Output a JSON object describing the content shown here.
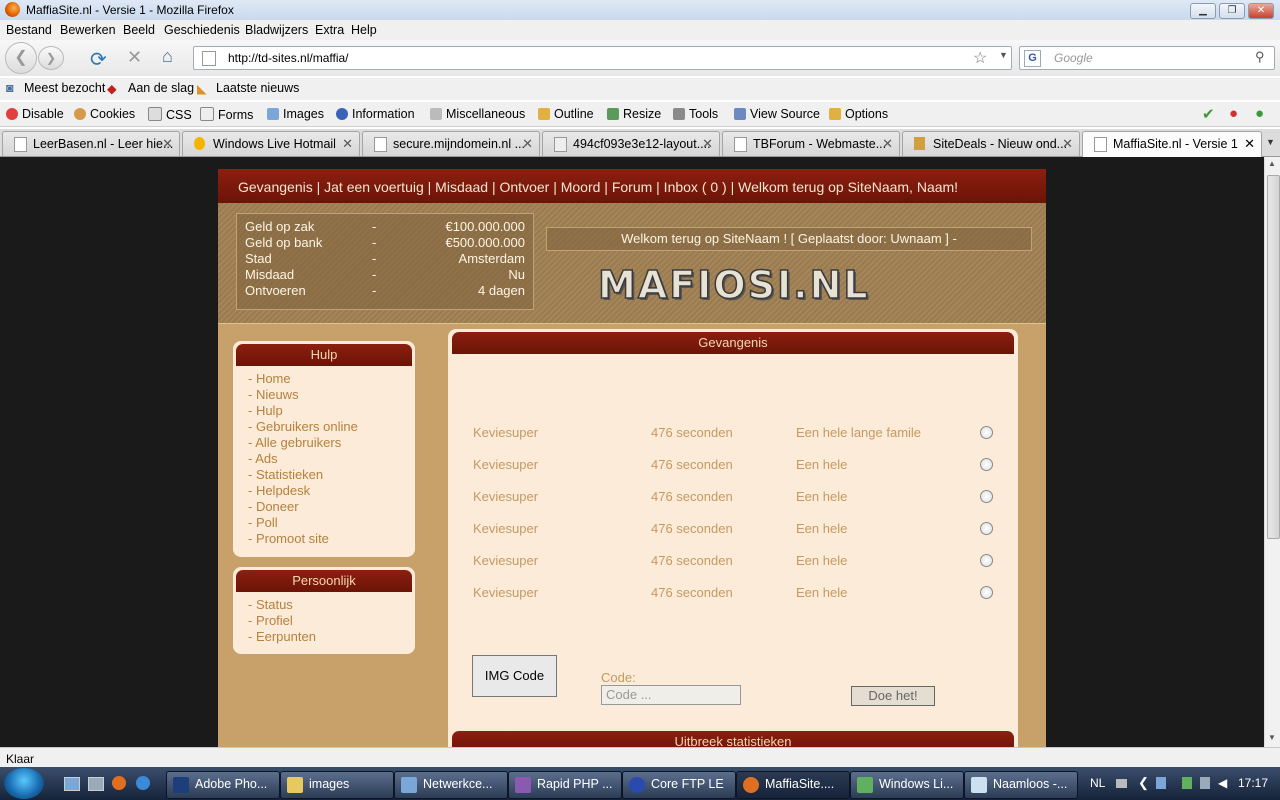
{
  "window": {
    "title": "MaffiaSite.nl - Versie 1 - Mozilla Firefox"
  },
  "menu": [
    "Bestand",
    "Bewerken",
    "Beeld",
    "Geschiedenis",
    "Bladwijzers",
    "Extra",
    "Help"
  ],
  "nav": {
    "url": "http://td-sites.nl/maffia/",
    "search_placeholder": "Google"
  },
  "bookmarks": [
    "Meest bezocht",
    "Aan de slag",
    "Laatste nieuws"
  ],
  "devtools": [
    "Disable",
    "Cookies",
    "CSS",
    "Forms",
    "Images",
    "Information",
    "Miscellaneous",
    "Outline",
    "Resize",
    "Tools",
    "View Source",
    "Options"
  ],
  "tabs": [
    {
      "label": "LeerBasen.nl - Leer hie..."
    },
    {
      "label": "Windows Live Hotmail"
    },
    {
      "label": "secure.mijndomein.nl ..."
    },
    {
      "label": "494cf093e3e12-layout...."
    },
    {
      "label": "TBForum - Webmaste..."
    },
    {
      "label": "SiteDeals - Nieuw ond..."
    },
    {
      "label": "MaffiaSite.nl - Versie 1"
    }
  ],
  "site": {
    "topnav": "Gevangenis | Jat een voertuig | Misdaad | Ontvoer | Moord | Forum | Inbox ( 0 ) | Welkom terug op SiteNaam, Naam!",
    "stats": [
      {
        "label": "Geld op zak",
        "sep": "-",
        "value": "€100.000.000"
      },
      {
        "label": "Geld op bank",
        "sep": "-",
        "value": "€500.000.000"
      },
      {
        "label": "Stad",
        "sep": "-",
        "value": "Amsterdam"
      },
      {
        "label": "Misdaad",
        "sep": "-",
        "value": "Nu"
      },
      {
        "label": "Ontvoeren",
        "sep": "-",
        "value": "4 dagen"
      }
    ],
    "welcome": "Welkom terug op SiteNaam ! [ Geplaatst door: Uwnaam ] -",
    "logo": "MAFIOSI.NL",
    "hulp": {
      "title": "Hulp",
      "links": [
        "- Home",
        "- Nieuws",
        "- Hulp",
        "- Gebruikers online",
        "- Alle gebruikers",
        "- Ads",
        "- Statistieken",
        "- Helpdesk",
        "- Doneer",
        "- Poll",
        "- Promoot site"
      ]
    },
    "persoonlijk": {
      "title": "Persoonlijk",
      "links": [
        "- Status",
        "- Profiel",
        "- Eerpunten"
      ]
    },
    "gevangenis": {
      "title": "Gevangenis",
      "rows": [
        {
          "name": "Keviesuper",
          "time": "476 seconden",
          "family": "Een hele lange famile"
        },
        {
          "name": "Keviesuper",
          "time": "476 seconden",
          "family": "Een hele"
        },
        {
          "name": "Keviesuper",
          "time": "476 seconden",
          "family": "Een hele"
        },
        {
          "name": "Keviesuper",
          "time": "476 seconden",
          "family": "Een hele"
        },
        {
          "name": "Keviesuper",
          "time": "476 seconden",
          "family": "Een hele"
        },
        {
          "name": "Keviesuper",
          "time": "476 seconden",
          "family": "Een hele"
        }
      ],
      "img_code": "IMG Code",
      "code_label": "Code:",
      "code_placeholder": "Code ...",
      "submit": "Doe het!"
    },
    "uitbreek": "Uitbreek statistieken"
  },
  "status": "Klaar",
  "taskbar": {
    "items": [
      "Adobe Pho...",
      "images",
      "Netwerkce...",
      "Rapid PHP ...",
      "Core FTP LE",
      "MaffiaSite....",
      "Windows Li...",
      "Naamloos -..."
    ],
    "lang": "NL",
    "clock": "17:17"
  }
}
